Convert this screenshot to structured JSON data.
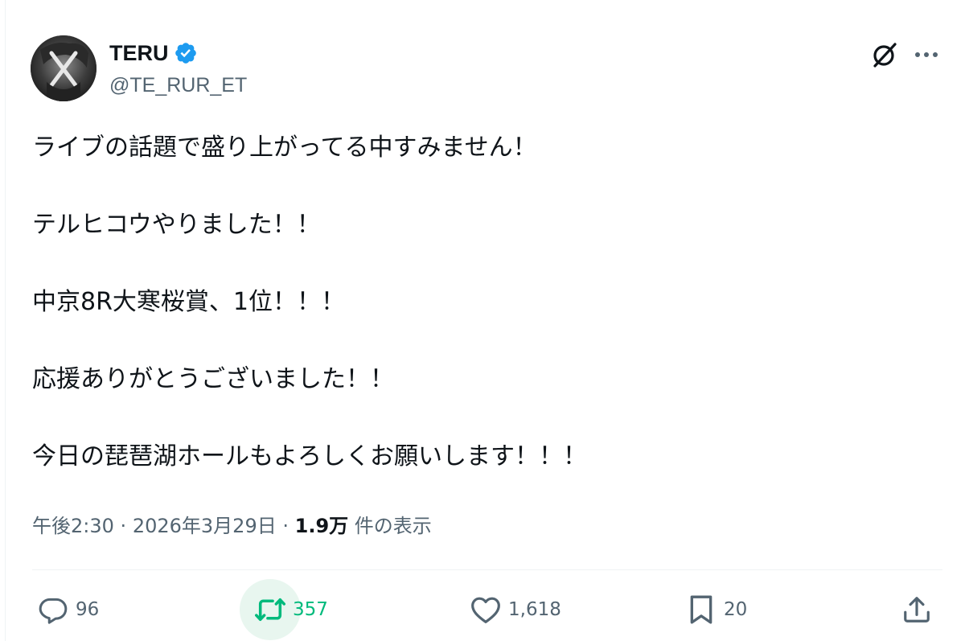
{
  "author": {
    "display_name": "TERU",
    "handle": "@TE_RUR_ET",
    "verified": true
  },
  "tweet": {
    "lines": [
      "ライブの話題で盛り上がってる中すみません！",
      "テルヒコウやりました！！",
      "中京8R大寒桜賞、1位！！！",
      "応援ありがとうございました！！",
      "今日の琵琶湖ホールもよろしくお願いします！！！"
    ]
  },
  "meta": {
    "time": "午後2:30",
    "date": "2026年3月29日",
    "views_count": "1.9万",
    "views_label": "件の表示",
    "separator": "·"
  },
  "actions": {
    "replies": "96",
    "retweets": "357",
    "likes": "1,618",
    "bookmarks": "20"
  },
  "colors": {
    "text": "#0f1419",
    "secondary": "#536471",
    "verified_blue": "#1d9bf0",
    "retweet_green": "#00ba7c"
  },
  "icons": {
    "reply": "reply-icon",
    "retweet": "retweet-icon",
    "like": "heart-icon",
    "bookmark": "bookmark-icon",
    "share": "share-icon",
    "grok": "grok-icon",
    "more": "more-icon",
    "verified": "verified-badge-icon"
  }
}
